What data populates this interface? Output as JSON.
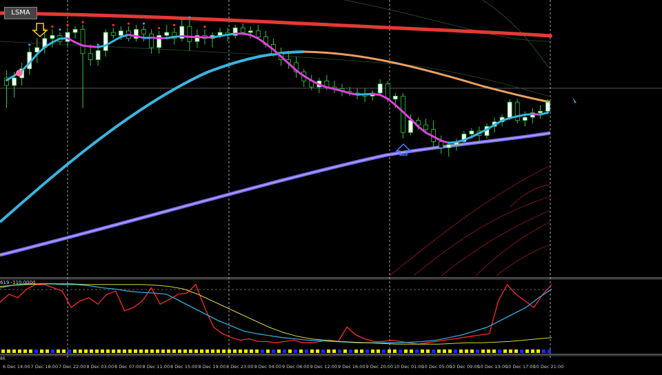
{
  "chart": {
    "badge_label": "LSMA",
    "indicator_label": "619 -110.0000",
    "bottom_label": "86"
  },
  "colors": {
    "background": "#000000",
    "bull_candle": "#ffffff",
    "bear_candle": "#000000",
    "candle_wick": "#2ecc40",
    "red_ma": "#e53935",
    "orange_ma": "#e8a060",
    "blue_ma": "#3ab4e0",
    "purple_ma": "#7b6cf0",
    "magenta_ma": "#e040e0",
    "osc_red": "#ff2a2a",
    "osc_blue": "#33aadd",
    "osc_yellow": "#d8d840",
    "dot_yellow": "#ffee00",
    "dot_blue": "#1030ff"
  },
  "chart_data": {
    "type": "candlestick",
    "x_labels": [
      "6 Dec 14:00",
      "7 Dec 18:00",
      "7 Dec 22:00",
      "8 Dec 03:00",
      "8 Dec 07:00",
      "8 Dec 11:00",
      "8 Dec 15:00",
      "8 Dec 19:00",
      "8 Dec 23:00",
      "9 Dec 04:00",
      "9 Dec 08:00",
      "9 Dec 12:00",
      "9 Dec 16:00",
      "9 Dec 20:00",
      "10 Dec 01:00",
      "10 Dec 05:00",
      "10 Dec 09:00",
      "10 Dec 13:00",
      "10 Dec 17:00",
      "10 Dec 21:00"
    ],
    "candles": [
      {
        "o": 60,
        "h": 65,
        "l": 40,
        "c": 55
      },
      {
        "o": 55,
        "h": 64,
        "l": 47,
        "c": 60
      },
      {
        "o": 60,
        "h": 70,
        "l": 55,
        "c": 66
      },
      {
        "o": 66,
        "h": 80,
        "l": 62,
        "c": 77
      },
      {
        "o": 77,
        "h": 86,
        "l": 70,
        "c": 80
      },
      {
        "o": 80,
        "h": 90,
        "l": 76,
        "c": 86
      },
      {
        "o": 86,
        "h": 92,
        "l": 80,
        "c": 88
      },
      {
        "o": 88,
        "h": 90,
        "l": 82,
        "c": 84
      },
      {
        "o": 84,
        "h": 93,
        "l": 80,
        "c": 90
      },
      {
        "o": 90,
        "h": 94,
        "l": 86,
        "c": 92
      },
      {
        "o": 92,
        "h": 95,
        "l": 40,
        "c": 76
      },
      {
        "o": 76,
        "h": 82,
        "l": 68,
        "c": 72
      },
      {
        "o": 72,
        "h": 80,
        "l": 68,
        "c": 78
      },
      {
        "o": 78,
        "h": 92,
        "l": 74,
        "c": 90
      },
      {
        "o": 90,
        "h": 93,
        "l": 86,
        "c": 88
      },
      {
        "o": 88,
        "h": 94,
        "l": 85,
        "c": 91
      },
      {
        "o": 91,
        "h": 94,
        "l": 84,
        "c": 86
      },
      {
        "o": 86,
        "h": 95,
        "l": 84,
        "c": 92
      },
      {
        "o": 92,
        "h": 94,
        "l": 84,
        "c": 89
      },
      {
        "o": 89,
        "h": 92,
        "l": 76,
        "c": 80
      },
      {
        "o": 80,
        "h": 91,
        "l": 76,
        "c": 88
      },
      {
        "o": 88,
        "h": 95,
        "l": 86,
        "c": 90
      },
      {
        "o": 90,
        "h": 93,
        "l": 82,
        "c": 86
      },
      {
        "o": 86,
        "h": 99,
        "l": 84,
        "c": 94
      },
      {
        "o": 94,
        "h": 98,
        "l": 78,
        "c": 84
      },
      {
        "o": 84,
        "h": 92,
        "l": 80,
        "c": 88
      },
      {
        "o": 88,
        "h": 92,
        "l": 82,
        "c": 86
      },
      {
        "o": 86,
        "h": 90,
        "l": 80,
        "c": 88
      },
      {
        "o": 88,
        "h": 93,
        "l": 86,
        "c": 90
      },
      {
        "o": 90,
        "h": 93,
        "l": 84,
        "c": 88
      },
      {
        "o": 88,
        "h": 95,
        "l": 86,
        "c": 93
      },
      {
        "o": 93,
        "h": 96,
        "l": 88,
        "c": 90
      },
      {
        "o": 90,
        "h": 94,
        "l": 86,
        "c": 91
      },
      {
        "o": 91,
        "h": 95,
        "l": 86,
        "c": 87
      },
      {
        "o": 87,
        "h": 91,
        "l": 80,
        "c": 82
      },
      {
        "o": 82,
        "h": 86,
        "l": 74,
        "c": 76
      },
      {
        "o": 76,
        "h": 80,
        "l": 68,
        "c": 72
      },
      {
        "o": 72,
        "h": 78,
        "l": 66,
        "c": 70
      },
      {
        "o": 70,
        "h": 74,
        "l": 60,
        "c": 64
      },
      {
        "o": 64,
        "h": 66,
        "l": 54,
        "c": 58
      },
      {
        "o": 58,
        "h": 62,
        "l": 52,
        "c": 54
      },
      {
        "o": 54,
        "h": 60,
        "l": 50,
        "c": 58
      },
      {
        "o": 58,
        "h": 62,
        "l": 52,
        "c": 54
      },
      {
        "o": 54,
        "h": 58,
        "l": 50,
        "c": 53
      },
      {
        "o": 53,
        "h": 56,
        "l": 48,
        "c": 51
      },
      {
        "o": 51,
        "h": 54,
        "l": 48,
        "c": 50
      },
      {
        "o": 50,
        "h": 53,
        "l": 46,
        "c": 49
      },
      {
        "o": 49,
        "h": 53,
        "l": 44,
        "c": 48
      },
      {
        "o": 48,
        "h": 52,
        "l": 45,
        "c": 50
      },
      {
        "o": 50,
        "h": 59,
        "l": 48,
        "c": 56
      },
      {
        "o": 56,
        "h": 58,
        "l": 44,
        "c": 46
      },
      {
        "o": 46,
        "h": 50,
        "l": 40,
        "c": 48
      },
      {
        "o": 48,
        "h": 50,
        "l": 20,
        "c": 24
      },
      {
        "o": 24,
        "h": 36,
        "l": 22,
        "c": 32
      },
      {
        "o": 32,
        "h": 34,
        "l": 26,
        "c": 29
      },
      {
        "o": 29,
        "h": 33,
        "l": 24,
        "c": 26
      },
      {
        "o": 26,
        "h": 32,
        "l": 14,
        "c": 18
      },
      {
        "o": 18,
        "h": 22,
        "l": 10,
        "c": 14
      },
      {
        "o": 14,
        "h": 18,
        "l": 8,
        "c": 16
      },
      {
        "o": 16,
        "h": 20,
        "l": 12,
        "c": 18
      },
      {
        "o": 18,
        "h": 25,
        "l": 16,
        "c": 23
      },
      {
        "o": 23,
        "h": 27,
        "l": 20,
        "c": 25
      },
      {
        "o": 25,
        "h": 28,
        "l": 18,
        "c": 22
      },
      {
        "o": 22,
        "h": 30,
        "l": 20,
        "c": 28
      },
      {
        "o": 28,
        "h": 34,
        "l": 24,
        "c": 31
      },
      {
        "o": 31,
        "h": 36,
        "l": 28,
        "c": 34
      },
      {
        "o": 34,
        "h": 46,
        "l": 32,
        "c": 44
      },
      {
        "o": 44,
        "h": 46,
        "l": 30,
        "c": 32
      },
      {
        "o": 32,
        "h": 38,
        "l": 28,
        "c": 34
      },
      {
        "o": 34,
        "h": 40,
        "l": 30,
        "c": 37
      },
      {
        "o": 37,
        "h": 42,
        "l": 33,
        "c": 38
      },
      {
        "o": 38,
        "h": 46,
        "l": 36,
        "c": 44
      }
    ],
    "oscillator": {
      "red": [
        68,
        80,
        75,
        88,
        95,
        95,
        90,
        85,
        60,
        70,
        75,
        65,
        80,
        85,
        55,
        60,
        70,
        90,
        65,
        72,
        80,
        82,
        95,
        60,
        30,
        20,
        14,
        10,
        12,
        8,
        8,
        6,
        8,
        10,
        6,
        6,
        8,
        10,
        8,
        30,
        18,
        12,
        8,
        8,
        10,
        8,
        6,
        4,
        6,
        8,
        10,
        12,
        14,
        16,
        18,
        20,
        70,
        95,
        80,
        70,
        60,
        80,
        95
      ],
      "blue": [
        90,
        94,
        96,
        96,
        96,
        95,
        95,
        93,
        90,
        88,
        85,
        83,
        82,
        80,
        70,
        60,
        50,
        40,
        32,
        24,
        20,
        17,
        14,
        12,
        10,
        9,
        8,
        7,
        6,
        6,
        6,
        6,
        7,
        8,
        10,
        14,
        18,
        24,
        30,
        40,
        50,
        60,
        75,
        88
      ],
      "yellow": [
        92,
        94,
        95,
        96,
        96,
        96,
        95,
        95,
        95,
        95,
        95,
        94,
        92,
        88,
        80,
        70,
        60,
        50,
        40,
        30,
        22,
        16,
        12,
        10,
        8,
        7,
        6,
        5,
        4,
        4,
        4,
        4,
        5,
        6,
        6,
        7,
        8,
        10,
        12,
        14
      ]
    },
    "ylim": [
      0,
      100
    ]
  }
}
